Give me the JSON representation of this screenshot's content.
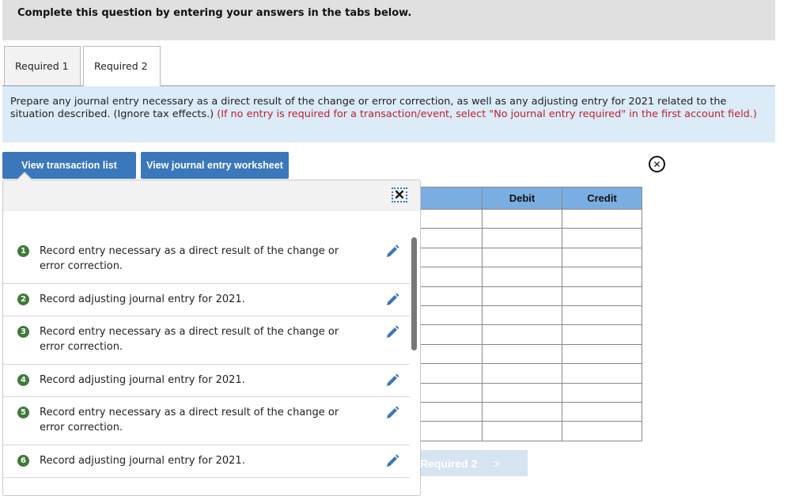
{
  "header": {
    "title": "Complete this question by entering your answers in the tabs below."
  },
  "tabs": [
    {
      "label": "Required 1",
      "active": false
    },
    {
      "label": "Required 2",
      "active": true
    }
  ],
  "instructions": {
    "main": "Prepare any journal entry necessary as a direct result of the change or error correction, as well as any adjusting entry for 2021 related to the situation described. (Ignore tax effects.) ",
    "note": "(If no entry is required for a transaction/event, select \"No journal entry required\" in the first account field.)"
  },
  "buttons": {
    "view_transaction_list": "View transaction list",
    "view_journal_worksheet": "View journal entry worksheet",
    "next": "Required 2",
    "next_chevron": ">"
  },
  "icons": {
    "close_circle": "⊗",
    "close_x": "✕",
    "edit": "pencil-icon"
  },
  "transactions": [
    {
      "num": "1",
      "text": "Record entry necessary as a direct result of the change or error correction."
    },
    {
      "num": "2",
      "text": "Record adjusting journal entry for 2021."
    },
    {
      "num": "3",
      "text": "Record entry necessary as a direct result of the change or error correction."
    },
    {
      "num": "4",
      "text": "Record adjusting journal entry for 2021."
    },
    {
      "num": "5",
      "text": "Record entry necessary as a direct result of the change or error correction."
    },
    {
      "num": "6",
      "text": "Record adjusting journal entry for 2021."
    }
  ],
  "journal_table": {
    "headers": [
      "",
      "Debit",
      "Credit"
    ],
    "row_count": 12
  },
  "colors": {
    "accent_blue": "#3a77bb",
    "table_header": "#7aaee3",
    "instruction_bg": "#dbebf8",
    "note_red": "#c0202e",
    "badge_green": "#3e7b3a"
  }
}
